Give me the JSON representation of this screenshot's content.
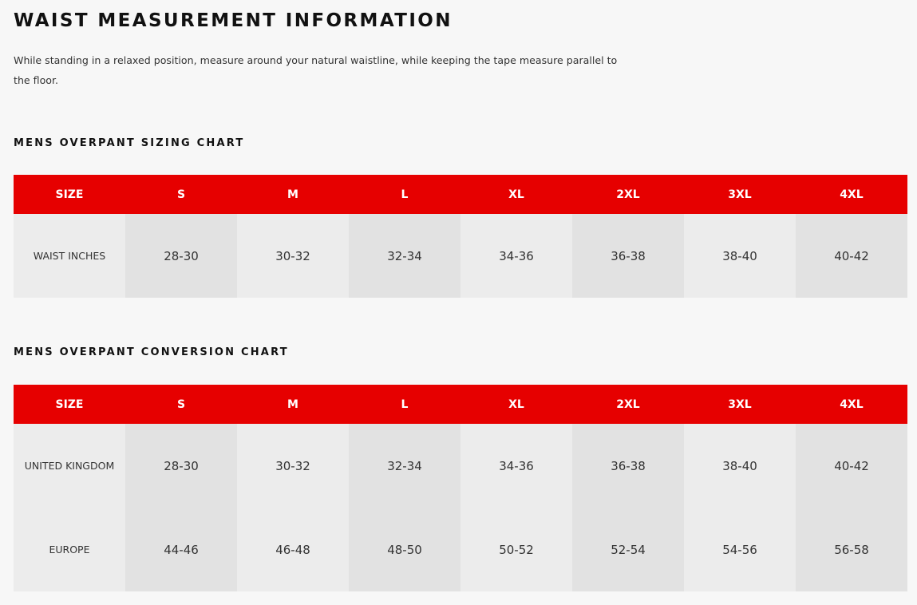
{
  "page": {
    "title": "WAIST MEASUREMENT INFORMATION",
    "intro": "While standing in a relaxed position, measure around your natural waistline, while keeping the tape measure parallel to the floor."
  },
  "sizing_chart": {
    "title": "MENS OVERPANT SIZING CHART",
    "headers": [
      "SIZE",
      "S",
      "M",
      "L",
      "XL",
      "2XL",
      "3XL",
      "4XL"
    ],
    "rows": [
      {
        "label": "WAIST INCHES",
        "values": [
          "28-30",
          "30-32",
          "32-34",
          "34-36",
          "36-38",
          "38-40",
          "40-42"
        ]
      }
    ]
  },
  "conversion_chart": {
    "title": "MENS OVERPANT CONVERSION CHART",
    "headers": [
      "SIZE",
      "S",
      "M",
      "L",
      "XL",
      "2XL",
      "3XL",
      "4XL"
    ],
    "rows": [
      {
        "label": "UNITED KINGDOM",
        "values": [
          "28-30",
          "30-32",
          "32-34",
          "34-36",
          "36-38",
          "38-40",
          "40-42"
        ]
      },
      {
        "label": "EUROPE",
        "values": [
          "44-46",
          "46-48",
          "48-50",
          "50-52",
          "52-54",
          "54-56",
          "56-58"
        ]
      }
    ]
  },
  "colors": {
    "header_red": "#e60000",
    "background": "#f7f7f7",
    "cell_light": "#ececec",
    "cell_dark": "#e2e2e2"
  }
}
